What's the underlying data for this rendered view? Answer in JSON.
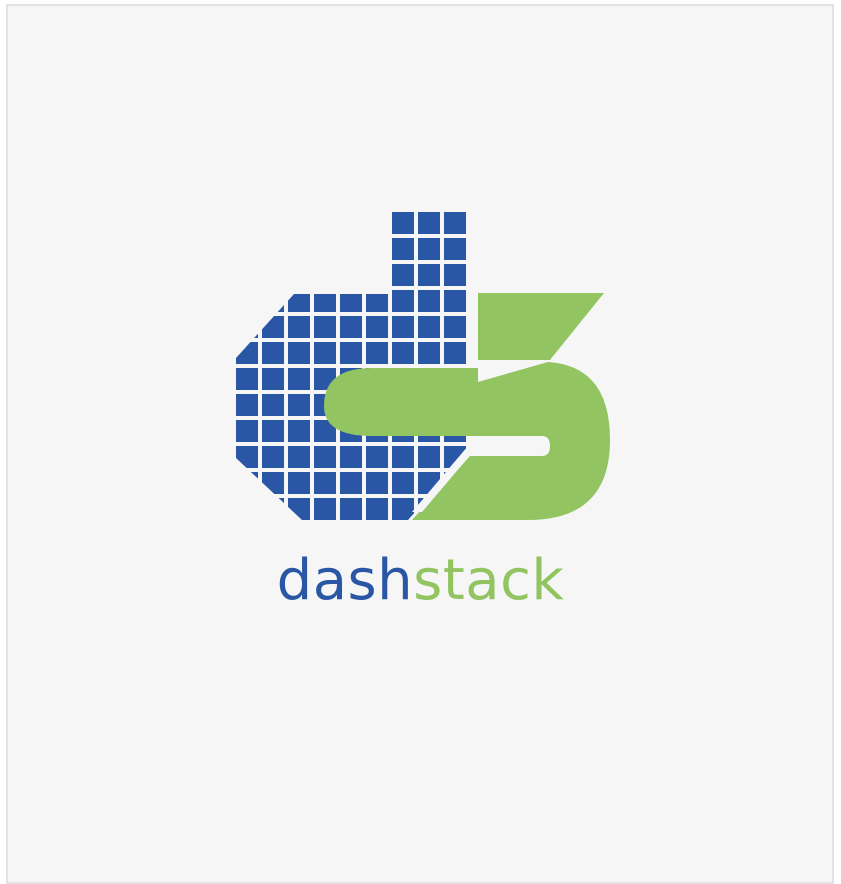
{
  "brand": {
    "name_part1": "dash",
    "name_part2": "stack",
    "colors": {
      "blue": "#2a57a5",
      "green": "#93c462",
      "background": "#f6f6f7",
      "border": "#e2e2e4"
    },
    "logo_icon": "dashstack-logo-icon"
  }
}
